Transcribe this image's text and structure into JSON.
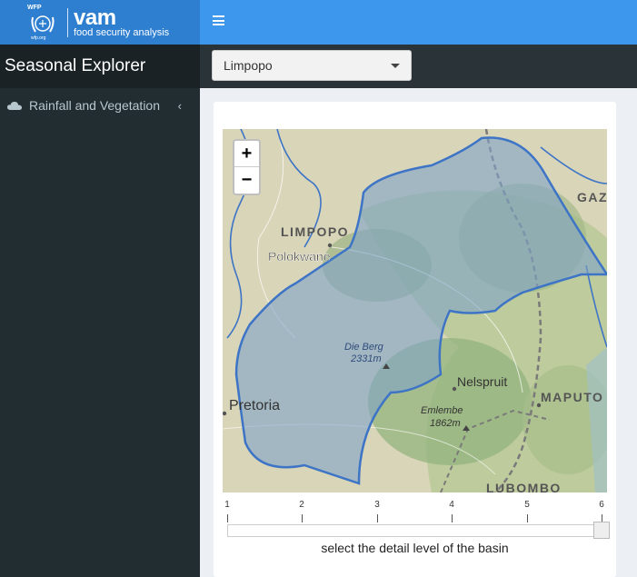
{
  "header": {
    "logo_wfp": "WFP",
    "logo_vam": "vam",
    "logo_subtitle": "food security analysis",
    "logo_url_text": "wfp.org"
  },
  "sidebar": {
    "title": "Seasonal Explorer",
    "items": [
      {
        "label": "Rainfall and Vegetation",
        "icon": "cloud-icon",
        "expand_icon": "chevron-left-icon"
      }
    ]
  },
  "controls": {
    "region_select": {
      "selected": "Limpopo"
    }
  },
  "map": {
    "zoom_in": "+",
    "zoom_out": "−",
    "labels": {
      "limpopo": "LIMPOPO",
      "polokwane": "Polokwane",
      "gaza": "GAZ",
      "die_berg": "Die Berg",
      "die_berg_elev": "2331m",
      "nelspruit": "Nelspruit",
      "maputo": "MAPUTO",
      "pretoria": "Pretoria",
      "emlembe": "Emlembe",
      "emlembe_elev": "1862m",
      "lubombo": "LUBOMBO"
    },
    "colors": {
      "basin_fill": "#7fa4c9",
      "basin_stroke": "#3d74c6",
      "land": "#d6d2b6",
      "vegetation": "#a8bf89"
    }
  },
  "slider": {
    "ticks": [
      "1",
      "2",
      "3",
      "4",
      "5",
      "6"
    ],
    "value": 6,
    "min": 1,
    "max": 6,
    "caption": "select the detail level of the basin"
  }
}
